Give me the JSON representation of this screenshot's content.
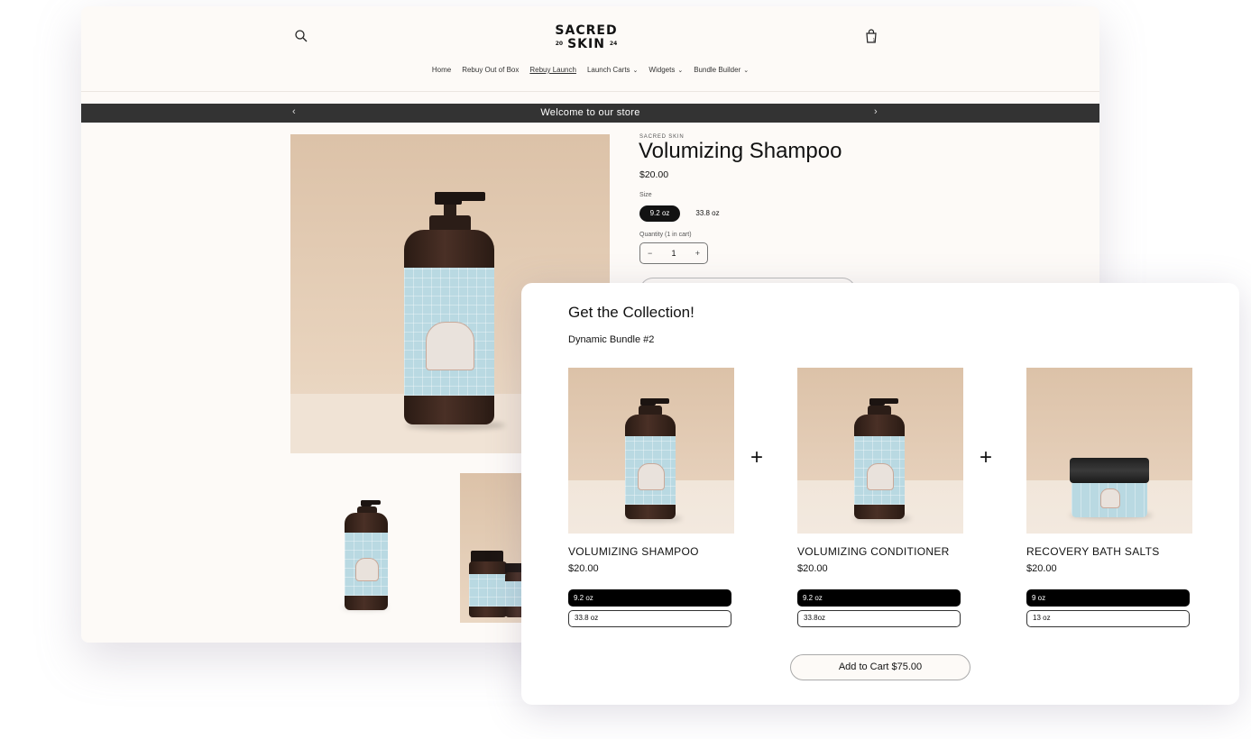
{
  "store": {
    "logo": {
      "line1": "SACRED",
      "line2": "SKIN",
      "year_left": "20",
      "year_right": "24"
    },
    "header_icons": {
      "search": "search-icon",
      "cart": "cart-icon"
    },
    "nav": [
      {
        "label": "Home"
      },
      {
        "label": "Rebuy Out of Box"
      },
      {
        "label": "Rebuy Launch",
        "active": true
      },
      {
        "label": "Launch Carts",
        "dropdown": true
      },
      {
        "label": "Widgets",
        "dropdown": true
      },
      {
        "label": "Bundle Builder",
        "dropdown": true
      }
    ],
    "announcement": {
      "text": "Welcome to our store",
      "prev": "‹",
      "next": "›"
    },
    "product": {
      "vendor": "SACRED SKIN",
      "title": "Volumizing Shampoo",
      "price": "$20.00",
      "size_label": "Size",
      "sizes": [
        "9.2 oz",
        "33.8 oz"
      ],
      "selected_size": "9.2 oz",
      "quantity_label": "Quantity (1 in cart)",
      "quantity": "1",
      "qty_minus": "−",
      "qty_plus": "+"
    }
  },
  "modal": {
    "title": "Get the Collection!",
    "subtitle": "Dynamic Bundle #2",
    "items": [
      {
        "name": "VOLUMIZING SHAMPOO",
        "price": "$20.00",
        "options": [
          "9.2 oz",
          "33.8 oz"
        ],
        "selected": "9.2 oz"
      },
      {
        "name": "VOLUMIZING CONDITIONER",
        "price": "$20.00",
        "options": [
          "9.2 oz",
          "33.8oz"
        ],
        "selected": "9.2 oz"
      },
      {
        "name": "RECOVERY BATH SALTS",
        "price": "$20.00",
        "options": [
          "9 oz",
          "13 oz"
        ],
        "selected": "9 oz"
      }
    ],
    "plus": "+",
    "add_to_cart": "Add to Cart $75.00"
  },
  "colors": {
    "page_bg": "#fdfaf7",
    "announcement_bg": "#333333",
    "selected_pill": "#121212",
    "label_blue": "#b9d9e2"
  }
}
